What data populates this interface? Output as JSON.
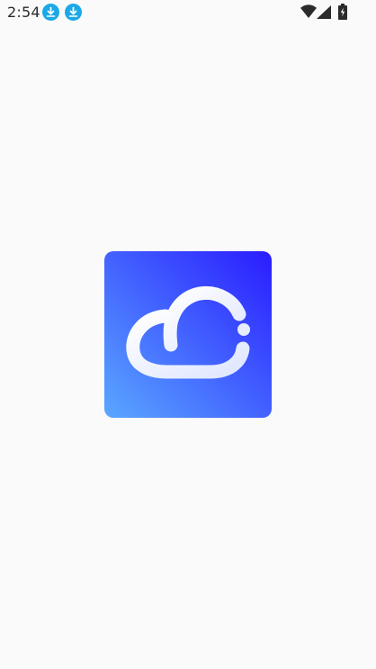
{
  "status_bar": {
    "time": "2:54",
    "notifications": [
      "download-icon",
      "download-icon"
    ],
    "system_icons": [
      "wifi-icon",
      "cellular-signal-icon",
      "battery-charging-icon"
    ],
    "colors": {
      "text": "#2b2b2b",
      "notification_accent": "#1aa8e6"
    }
  },
  "splash": {
    "logo_icon": "cloud-logo-icon",
    "colors": {
      "gradient_start": "#5aa7ff",
      "gradient_end": "#2a1cff",
      "cloud": "#eef2ff"
    }
  },
  "background_color": "#fafafa"
}
